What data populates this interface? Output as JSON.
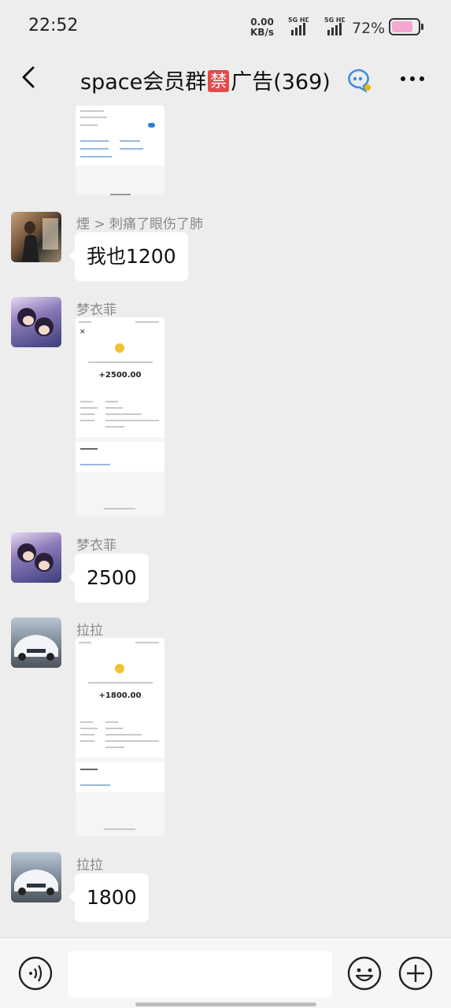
{
  "status_bar": {
    "time": "22:52",
    "net_speed_value": "0.00",
    "net_speed_unit": "KB/s",
    "signal_1": "5G HD",
    "signal_2": "5G HD",
    "battery_percent": "72%",
    "battery_color": "#f4a8cf"
  },
  "header": {
    "title_prefix": "space会员群",
    "title_ban": "禁",
    "title_suffix": "广告(369)",
    "back_icon": "chevron-left-icon",
    "group_icon": "group-chat-icon",
    "more_icon": "more-dots-icon"
  },
  "messages": [
    {
      "type": "image",
      "sender": "",
      "content": "payment-screenshot-partial"
    },
    {
      "type": "text",
      "sender": "煙 > 刺痛了眼伤了肺",
      "content": "我也1200"
    },
    {
      "type": "image",
      "sender": "梦衣菲",
      "content": "payment-screenshot",
      "amount": "+2500.00"
    },
    {
      "type": "text",
      "sender": "梦衣菲",
      "content": "2500"
    },
    {
      "type": "image",
      "sender": "拉拉",
      "content": "payment-screenshot",
      "amount": "+1800.00"
    },
    {
      "type": "text",
      "sender": "拉拉",
      "content": "1800"
    }
  ],
  "input_bar": {
    "voice_icon": "voice-icon",
    "emoji_icon": "emoji-icon",
    "plus_icon": "plus-icon",
    "text_value": ""
  }
}
